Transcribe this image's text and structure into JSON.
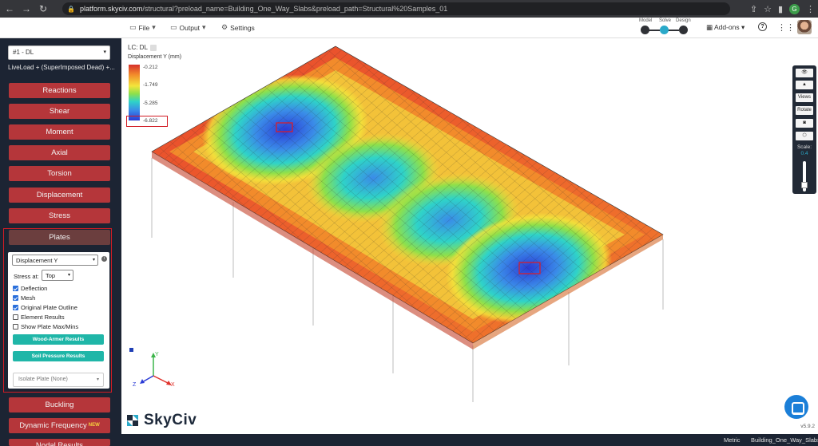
{
  "browser": {
    "url_host": "platform.skyciv.com",
    "url_path": "/structural?preload_name=Building_One_Way_Slabs&preload_path=Structural%20Samples_01",
    "profile_letter": "G"
  },
  "menu": {
    "file": "File",
    "output": "Output",
    "settings": "Settings",
    "addons": "Add-ons"
  },
  "workflow": {
    "model": "Model",
    "solve": "Solve",
    "design": "Design"
  },
  "sidebar": {
    "load_case": "#1 - DL",
    "load_combo_desc": "LiveLoad + (SuperImposed Dead) +...",
    "buttons": [
      "Reactions",
      "Shear",
      "Moment",
      "Axial",
      "Torsion",
      "Displacement",
      "Stress",
      "Plates"
    ],
    "plates_panel": {
      "result_type": "Displacement Y",
      "stress_at_label": "Stress at:",
      "stress_at_value": "Top",
      "checkboxes": [
        {
          "label": "Deflection",
          "checked": true
        },
        {
          "label": "Mesh",
          "checked": true
        },
        {
          "label": "Original Plate Outline",
          "checked": true
        },
        {
          "label": "Element Results",
          "checked": false
        },
        {
          "label": "Show Plate Max/Mins",
          "checked": false
        }
      ],
      "wood_armer_button": "Wood-Armer Results",
      "soil_pressure_button": "Soil Pressure Results",
      "isolate_placeholder": "Isolate Plate (None)"
    },
    "lower_buttons": [
      "Buckling",
      "Dynamic Frequency",
      "Nodal Results"
    ],
    "new_badge": "NEW"
  },
  "canvas": {
    "lc_tag": "LC: DL",
    "legend_title": "Displacement Y (mm)",
    "legend_ticks": [
      "-0.212",
      "-1.749",
      "-5.285",
      "-6.822"
    ],
    "axis_y": "Y",
    "axis_z": "Z",
    "axis_x": "X",
    "brand": "SkyCiv",
    "version": "v5.9.2"
  },
  "right_tools": {
    "views": "Views",
    "rotate": "Rotate",
    "scale_label": "Scale:",
    "scale_value": "0.4"
  },
  "status_bar": {
    "units": "Metric",
    "file_name": "Building_One_Way_Slabs"
  }
}
